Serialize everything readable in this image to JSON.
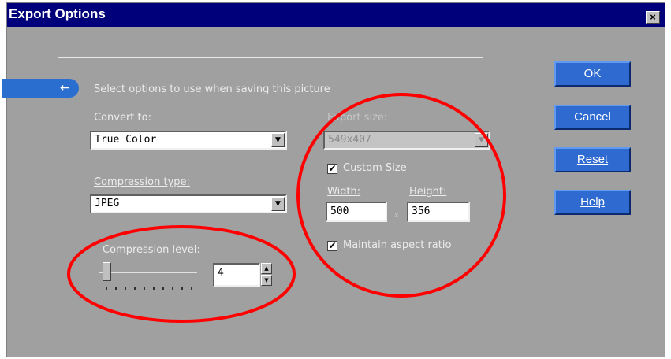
{
  "window": {
    "title": "Export Options",
    "close_label": "×"
  },
  "intro": {
    "text": "Select options to use when saving this picture",
    "arrow": "←"
  },
  "convert": {
    "label": "Convert to:",
    "value": "True Color"
  },
  "compression_type": {
    "label": "Compression type:",
    "value": "JPEG"
  },
  "compression_level": {
    "label": "Compression level:",
    "value": "4"
  },
  "export_size": {
    "label": "Export size:",
    "value": "549x407"
  },
  "custom_size": {
    "label": "Custom Size",
    "checked": "✔"
  },
  "width": {
    "label": "Width:",
    "value": "500"
  },
  "height": {
    "label": "Height:",
    "value": "356"
  },
  "size_separator": "x",
  "maintain_aspect": {
    "label": "Maintain aspect ratio",
    "checked": "✔"
  },
  "buttons": {
    "ok": "OK",
    "cancel": "Cancel",
    "reset": "Reset",
    "help": "Help"
  },
  "icons": {
    "dropdown": "▼",
    "spin_up": "▲",
    "spin_down": "▼"
  },
  "colors": {
    "dialog_bg": "#a0a0a0",
    "title_bg": "#00007a",
    "button_blue": "#2f6ad0",
    "annotation_red": "#ff0000"
  }
}
